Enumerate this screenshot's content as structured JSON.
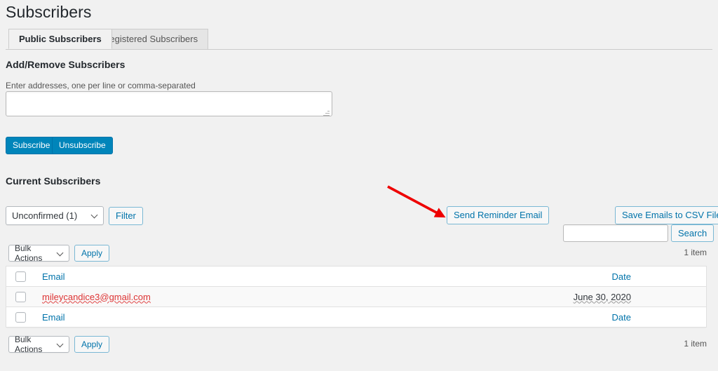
{
  "page": {
    "title": "Subscribers"
  },
  "tabs": [
    {
      "label": "Public Subscribers",
      "active": true
    },
    {
      "label": "Registered Subscribers",
      "active": false
    }
  ],
  "add_remove": {
    "heading": "Add/Remove Subscribers",
    "field_label": "Enter addresses, one per line or comma-separated",
    "textarea_value": "",
    "textarea_placeholder": "",
    "subscribe_label": "Subscribe",
    "unsubscribe_label": "Unsubscribe"
  },
  "current": {
    "heading": "Current Subscribers",
    "status_filter": {
      "selected": "Unconfirmed (1)",
      "options": [
        "Unconfirmed (1)"
      ]
    },
    "filter_label": "Filter",
    "send_reminder_label": "Send Reminder Email",
    "save_csv_label": "Save Emails to CSV File",
    "search_value": "",
    "search_placeholder": "",
    "search_label": "Search",
    "bulk_actions": {
      "selected": "Bulk Actions",
      "options": [
        "Bulk Actions"
      ]
    },
    "apply_label": "Apply",
    "item_count_top": "1 item",
    "item_count_bottom": "1 item"
  },
  "table": {
    "columns": [
      "Email",
      "Date"
    ],
    "header": {
      "email": "Email",
      "date": "Date"
    },
    "footer": {
      "email": "Email",
      "date": "Date"
    },
    "rows": [
      {
        "email": "mileycandice3@gmail.com",
        "date": "June 30, 2020"
      }
    ]
  },
  "annotation": {
    "arrow_color": "#ee0000",
    "points_to": "Send Reminder Email"
  },
  "colors": {
    "page_background": "#f1f1f1",
    "primary_button": "#0085ba",
    "link": "#0073aa",
    "email_value": "#dd3333"
  }
}
